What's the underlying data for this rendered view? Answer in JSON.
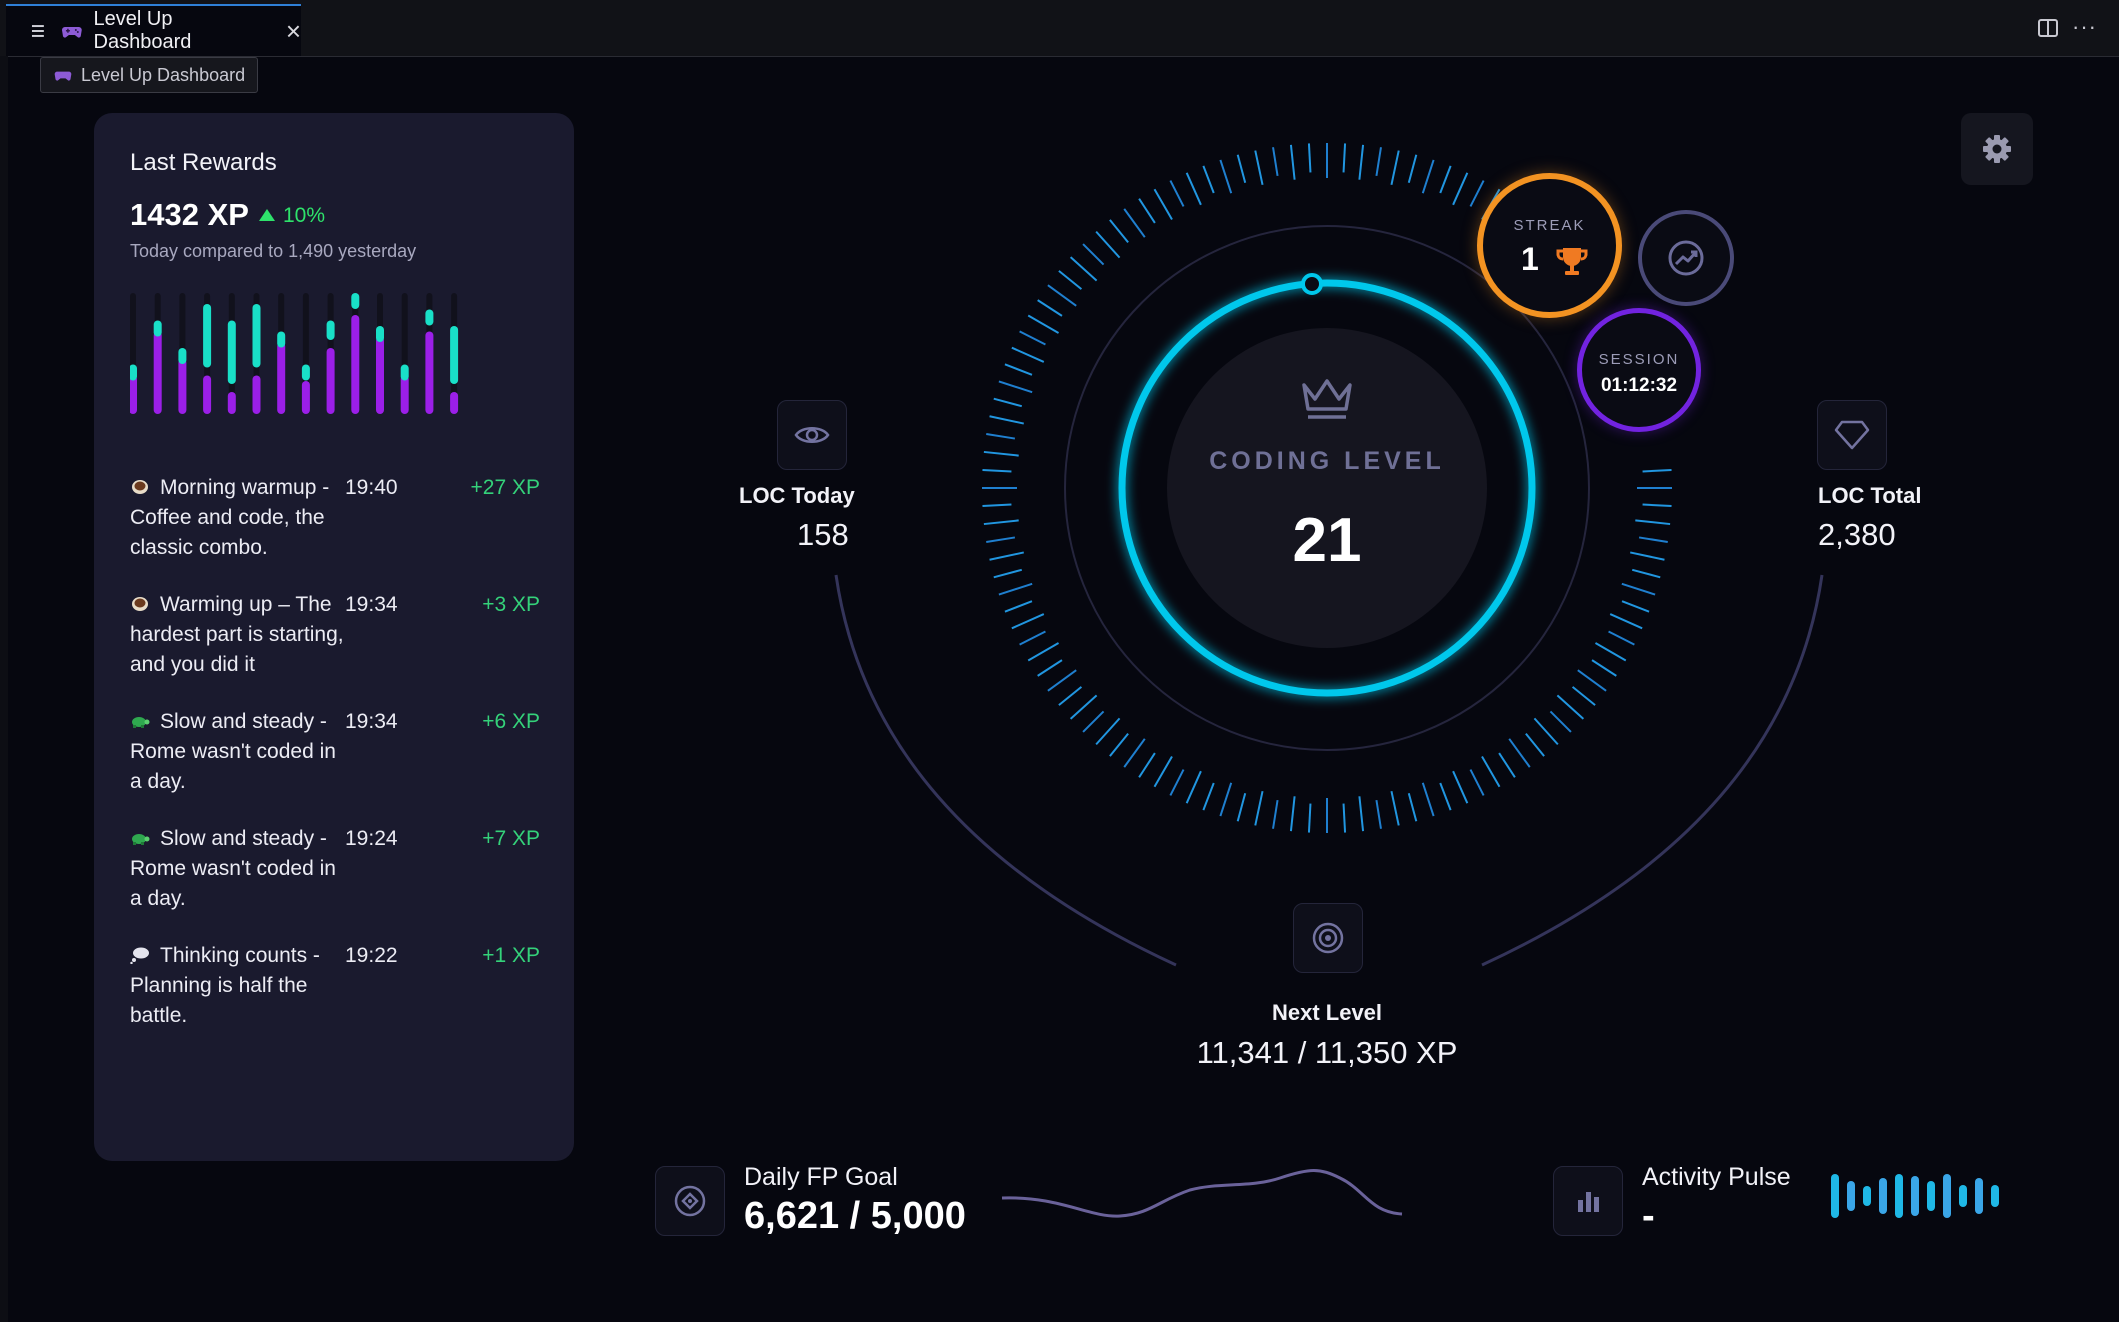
{
  "tab": {
    "title": "Level Up Dashboard",
    "tooltip": "Level Up Dashboard"
  },
  "rewards": {
    "heading": "Last Rewards",
    "xp_total": "1432 XP",
    "xp_change": "10%",
    "compare_text": "Today compared to 1,490 yesterday",
    "bar_chart": [
      {
        "top": 0.45,
        "bottom": 0.35
      },
      {
        "top": 0.85,
        "bottom": 0.75
      },
      {
        "top": 0.6,
        "bottom": 0.5
      },
      {
        "top": 1.0,
        "bottom": 0.35
      },
      {
        "top": 0.85,
        "bottom": 0.2
      },
      {
        "top": 1.0,
        "bottom": 0.35
      },
      {
        "top": 0.75,
        "bottom": 0.65
      },
      {
        "top": 0.45,
        "bottom": 0.3
      },
      {
        "top": 0.85,
        "bottom": 0.6
      },
      {
        "top": 1.1,
        "bottom": 0.9
      },
      {
        "top": 0.8,
        "bottom": 0.7
      },
      {
        "top": 0.45,
        "bottom": 0.35
      },
      {
        "top": 0.95,
        "bottom": 0.75
      },
      {
        "top": 0.8,
        "bottom": 0.2
      }
    ],
    "items": [
      {
        "emoji": "coffee",
        "title": "Morning warmup - Coffee and code, the classic combo.",
        "time": "19:40",
        "xp": "+27 XP"
      },
      {
        "emoji": "coffee",
        "title": "Warming up – The hardest part is starting, and you did it",
        "time": "19:34",
        "xp": "+3 XP"
      },
      {
        "emoji": "turtle",
        "title": "Slow and steady - Rome wasn't coded in a day.",
        "time": "19:34",
        "xp": "+6 XP"
      },
      {
        "emoji": "turtle",
        "title": "Slow and steady - Rome wasn't coded in a day.",
        "time": "19:24",
        "xp": "+7 XP"
      },
      {
        "emoji": "thought-bubble",
        "title": "Thinking counts - Planning is half the battle.",
        "time": "19:22",
        "xp": "+1 XP"
      }
    ]
  },
  "level": {
    "label": "CODING LEVEL",
    "value": "21",
    "progress": 0.9992
  },
  "streak": {
    "label": "STREAK",
    "value": "1"
  },
  "session": {
    "label": "SESSION",
    "value": "01:12:32"
  },
  "loc_today": {
    "label": "LOC Today",
    "value": "158"
  },
  "loc_total": {
    "label": "LOC Total",
    "value": "2,380"
  },
  "next_level": {
    "label": "Next Level",
    "value": "11,341 / 11,350 XP"
  },
  "daily_goal": {
    "label": "Daily FP Goal",
    "value": "6,621 / 5,000"
  },
  "activity": {
    "label": "Activity Pulse",
    "value": "-"
  },
  "colors": {
    "accent_cyan": "#00c8ec",
    "streak_orange": "#f39322",
    "session_purple": "#7223e0",
    "bar_teal": "#19e0c8",
    "bar_purple": "#9b1fe8",
    "positive_green": "#34d27a"
  }
}
